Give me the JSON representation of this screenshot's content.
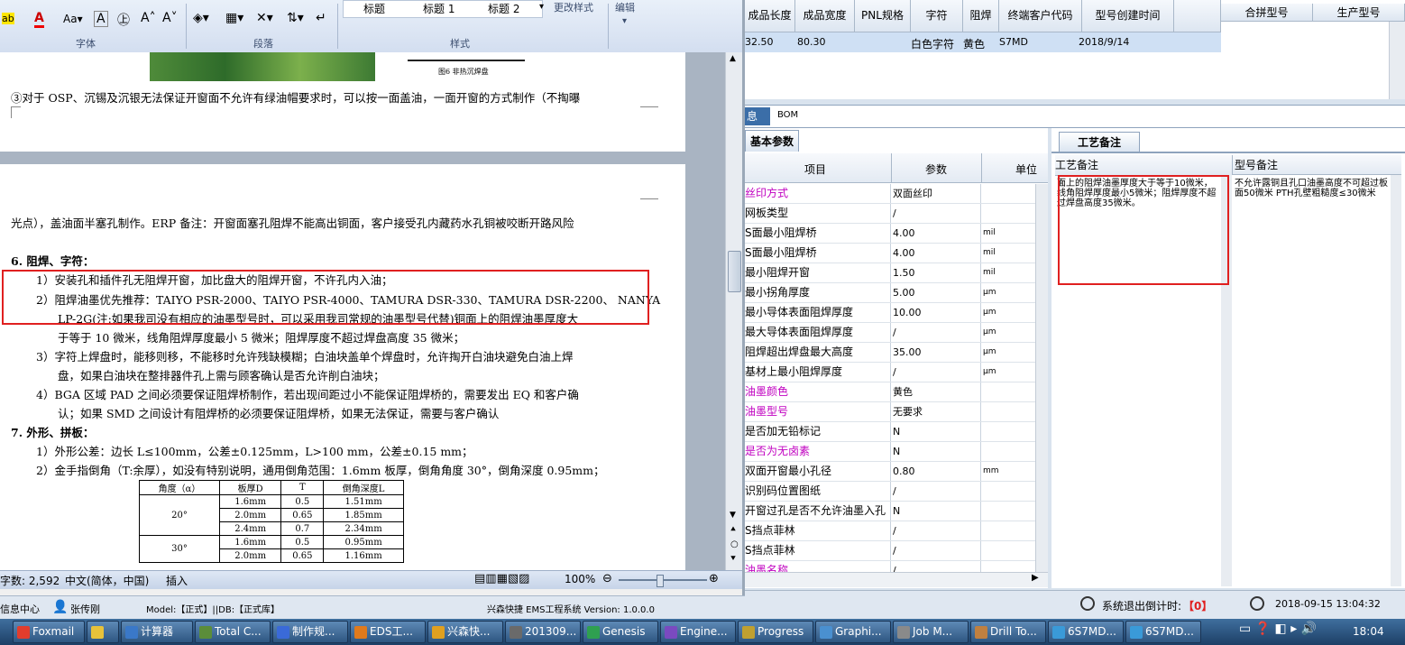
{
  "ems": {
    "top_grid_headers": [
      "成品长度",
      "成品宽度",
      "PNL规格",
      "字符",
      "阻焊",
      "终端客户代码",
      "型号创建时间"
    ],
    "top_grid_row": {
      "length": "32.50",
      "width": "80.30",
      "pnl": "",
      "char": "白色字符",
      "solder": "黄色",
      "customer": "S7MD",
      "created": "2018/9/14"
    },
    "right_grid_headers": [
      "合拼型号",
      "生产型号"
    ],
    "mid_tabs": [
      "息",
      "BOM"
    ],
    "params_tab": "基本参数",
    "param_headers": {
      "item": "项目",
      "param": "参数",
      "unit": "单位"
    },
    "params": [
      {
        "k": "丝印方式",
        "v": "双面丝印",
        "u": "",
        "magenta": true
      },
      {
        "k": "网板类型",
        "v": "/",
        "u": "",
        "magenta": false
      },
      {
        "k": "S面最小阻焊桥",
        "v": "4.00",
        "u": "mil",
        "magenta": false
      },
      {
        "k": "S面最小阻焊桥",
        "v": "4.00",
        "u": "mil",
        "magenta": false
      },
      {
        "k": "最小阻焊开窗",
        "v": "1.50",
        "u": "mil",
        "magenta": false
      },
      {
        "k": "最小拐角厚度",
        "v": "5.00",
        "u": "μm",
        "magenta": false
      },
      {
        "k": "最小导体表面阻焊厚度",
        "v": "10.00",
        "u": "μm",
        "magenta": false
      },
      {
        "k": "最大导体表面阻焊厚度",
        "v": "/",
        "u": "μm",
        "magenta": false
      },
      {
        "k": "阻焊超出焊盘最大高度",
        "v": "35.00",
        "u": "μm",
        "magenta": false
      },
      {
        "k": "基材上最小阻焊厚度",
        "v": "/",
        "u": "μm",
        "magenta": false
      },
      {
        "k": "油墨颜色",
        "v": "黄色",
        "u": "",
        "magenta": true
      },
      {
        "k": "油墨型号",
        "v": "无要求",
        "u": "",
        "magenta": true
      },
      {
        "k": "是否加无铅标记",
        "v": "N",
        "u": "",
        "magenta": false
      },
      {
        "k": "是否为无卤素",
        "v": "N",
        "u": "",
        "magenta": true
      },
      {
        "k": "双面开窗最小孔径",
        "v": "0.80",
        "u": "mm",
        "magenta": false
      },
      {
        "k": "识别码位置图纸",
        "v": "/",
        "u": "",
        "magenta": false
      },
      {
        "k": "开窗过孔是否不允许油墨入孔",
        "v": "N",
        "u": "",
        "magenta": false
      },
      {
        "k": "S挡点菲林",
        "v": "/",
        "u": "",
        "magenta": false
      },
      {
        "k": "S挡点菲林",
        "v": "/",
        "u": "",
        "magenta": false
      },
      {
        "k": "油墨名称",
        "v": "/",
        "u": "",
        "magenta": true
      }
    ],
    "craft_tab": "工艺备注",
    "craft_col1_header": "工艺备注",
    "craft_col2_header": "型号备注",
    "craft_note": "面上的阻焊油墨厚度大于等于10微米，线角阻焊厚度最小5微米；阻焊厚度不超过焊盘高度35微米。",
    "model_note": "不允许露铜且孔口油墨高度不可超过板面50微米    PTH孔壁粗糙度≤30微米",
    "countdown_label": "系统退出倒计时:",
    "countdown_value": "【0】",
    "datetime": "2018-09-15 13:04:32",
    "footer_left_user": "张传刚",
    "footer_left_msg": "信息中心",
    "footer_model": "Model:【正式】||DB:【正式库】",
    "footer_system": "兴森快捷 EMS工程系统 Version: 1.0.0.0"
  },
  "word": {
    "ribbon": {
      "font_group": "字体",
      "para_group": "段落",
      "style_group": "样式",
      "styles": [
        "标题",
        "标题 1",
        "标题 2"
      ],
      "change_style": "更改样式",
      "edit": "编辑"
    },
    "figure_caption": "图6 非热沉焊盘",
    "lines": {
      "l1": "③对于 OSP、沉锡及沉银无法保证开窗面不允许有绿油帽要求时，可以按一面盖油，一面开窗的方式制作（不掏曝",
      "l2": "光点），盖油面半塞孔制作。ERP 备注：开窗面塞孔阻焊不能高出铜面，客户接受孔内藏药水孔铜被咬断开路风险",
      "h6": "6.   阻焊、字符：",
      "p1": "1）安装孔和插件孔无阻焊开窗，加比盘大的阻焊开窗，不许孔内入油；",
      "p2a": "2）阻焊油墨优先推荐：TAIYO PSR-2000、TAIYO PSR-4000、TAMURA  DSR-330、TAMURA DSR-2200、 NANYA",
      "p2b": "LP-2G(注:如果我司没有相应的油墨型号时，可以采用我司常规的油墨型号代替)铜面上的阻焊油墨厚度大",
      "p2c": "于等于 10 微米，线角阻焊厚度最小 5 微米；阻焊厚度不超过焊盘高度 35 微米；",
      "p3a": "3）字符上焊盘时，能移则移，不能移时允许残缺模糊；白油块盖单个焊盘时，允许掏开白油块避免白油上焊",
      "p3b": "盘，如果白油块在整排器件孔上需与顾客确认是否允许削白油块；",
      "p4a": "4）BGA 区域 PAD 之间必须要保证阻焊桥制作，若出现间距过小不能保证阻焊桥的，需要发出 EQ 和客户确",
      "p4b": "认；如果 SMD 之间设计有阻焊桥的必须要保证阻焊桥，如果无法保证，需要与客户确认",
      "h7": "7.   外形、拼板：",
      "q1": "1）外形公差：边长 L≤100mm，公差±0.125mm，L>100 mm，公差±0.15 mm；",
      "q2": "2）金手指倒角（T:余厚），如没有特别说明，通用倒角范围：1.6mm 板厚，倒角角度 30°，倒角深度 0.95mm；"
    },
    "table": {
      "headers": [
        "角度（α）",
        "板厚D",
        "T",
        "倒角深度L"
      ],
      "rows": [
        [
          "20°",
          "1.6mm",
          "0.5",
          "1.51mm"
        ],
        [
          "",
          "2.0mm",
          "0.65",
          "1.85mm"
        ],
        [
          "",
          "2.4mm",
          "0.7",
          "2.34mm"
        ],
        [
          "30°",
          "1.6mm",
          "0.5",
          "0.95mm"
        ],
        [
          "",
          "2.0mm",
          "0.65",
          "1.16mm"
        ]
      ]
    },
    "status": {
      "words": "字数: 2,592",
      "lang": "中文(简体，中国)",
      "mode": "插入",
      "zoom": "100%"
    }
  },
  "taskbar": {
    "items": [
      "Foxmail",
      "",
      "计算器",
      "Total C...",
      "制作规...",
      "EDS工...",
      "兴森快...",
      "201309...",
      "Genesis",
      "Engine...",
      "Progress",
      "Graphi...",
      "Job M...",
      "Drill To...",
      "6S7MD...",
      "6S7MD..."
    ],
    "clock": "18:04"
  },
  "colors": {
    "highlight_red": "#e02020",
    "magenta": "#c000c0",
    "taskbar": "#2a4f7a"
  }
}
